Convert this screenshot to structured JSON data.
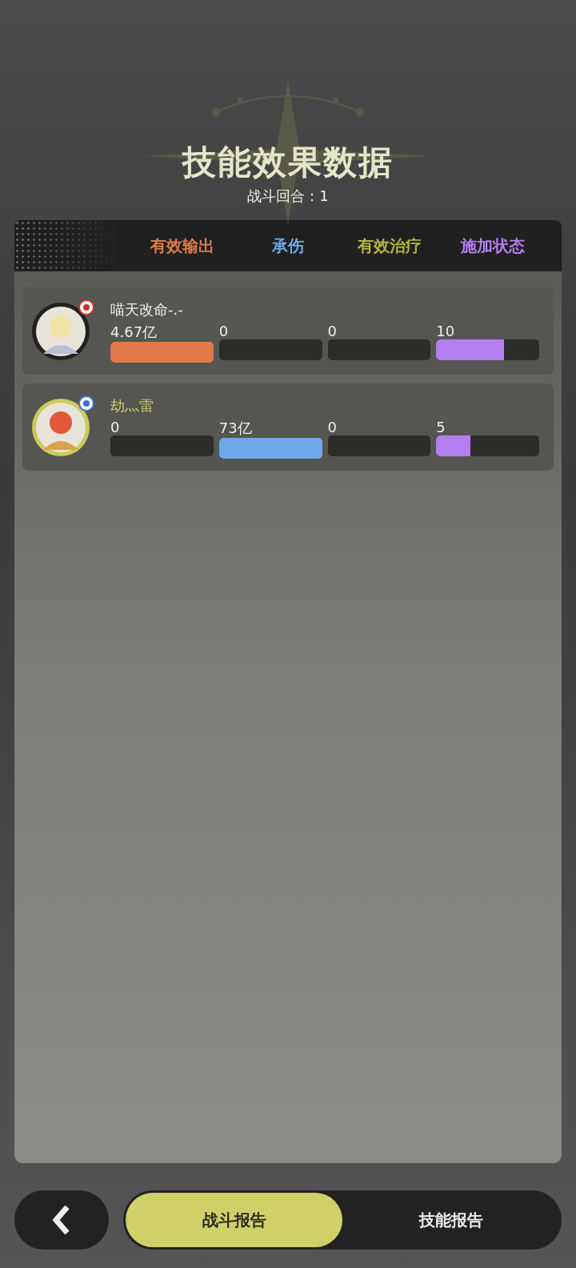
{
  "title": "技能效果数据",
  "subtitle": "战斗回合：1",
  "columns": [
    {
      "label": "有效输出",
      "color": "#e07a48"
    },
    {
      "label": "承伤",
      "color": "#6fa8e8"
    },
    {
      "label": "有效治疗",
      "color": "#b2b73c"
    },
    {
      "label": "施加状态",
      "color": "#b57ef0"
    }
  ],
  "players": [
    {
      "name": "喵天改命-.-",
      "color": "#eeeeee",
      "stats": [
        {
          "value": "4.67亿",
          "level": 1
        },
        {
          "value": "0",
          "level": 0
        },
        {
          "value": "0",
          "level": 0
        },
        {
          "value": "10",
          "level": 0.66
        }
      ]
    },
    {
      "name": "劫灬雷",
      "color": "#cfd168",
      "stats": [
        {
          "value": "0",
          "level": 0
        },
        {
          "value": "73亿",
          "level": 1
        },
        {
          "value": "0",
          "level": 0
        },
        {
          "value": "5",
          "level": 0.33
        }
      ]
    }
  ],
  "tabs": [
    {
      "label": "战斗报告",
      "selected": true
    },
    {
      "label": "技能报告",
      "selected": false
    }
  ]
}
